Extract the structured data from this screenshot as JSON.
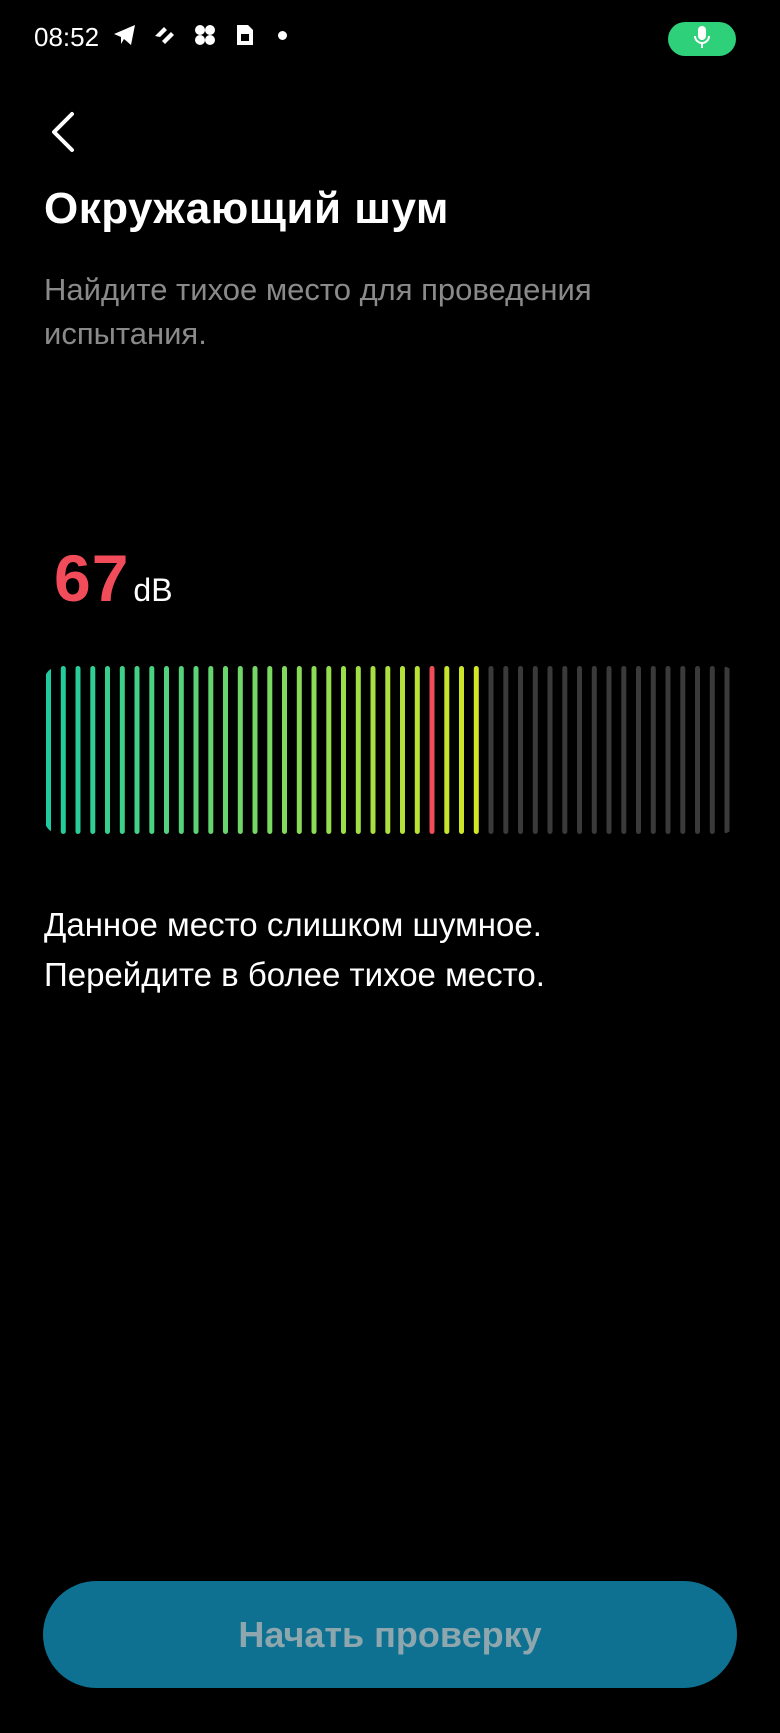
{
  "status_bar": {
    "time": "08:52",
    "icons": [
      "telegram-icon",
      "shortcut-icon",
      "grid-app-icon",
      "sim-card-icon",
      "notification-dot-icon"
    ],
    "mic_indicator": "microphone-icon",
    "accent_color": "#2fd07a"
  },
  "header": {
    "back_icon": "chevron-left-icon",
    "title": "Окружающий шум",
    "subtitle": "Найдите тихое место для проведения испытания."
  },
  "noise": {
    "value": "67",
    "unit": "dB",
    "value_color": "#f24c5a",
    "meter": {
      "total_bars": 47,
      "active_bars": 30,
      "marker_bar_index": 26,
      "marker_color": "#f24c5a",
      "gradient_start": "#1ecba0",
      "gradient_end": "#d2e624",
      "inactive_color": "#3a3a3a"
    }
  },
  "message": {
    "line1": "Данное место слишком шумное.",
    "line2": "Перейдите в более тихое место."
  },
  "actions": {
    "start_label": "Начать проверку",
    "button_color": "#0e7192"
  }
}
